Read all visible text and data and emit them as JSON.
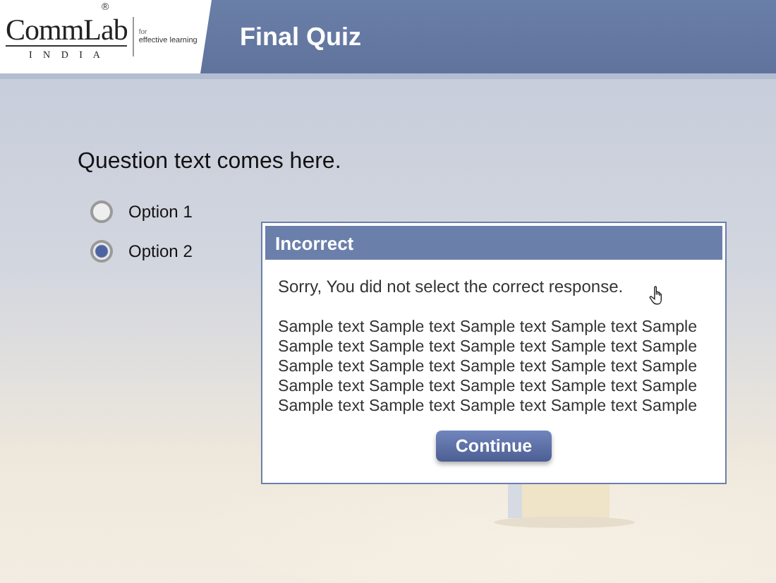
{
  "logo": {
    "name": "CommLab",
    "country": "I N D I A",
    "registered": "®",
    "for": "for",
    "tagline": "effective learning"
  },
  "title": "Final Quiz",
  "question": "Question text comes here.",
  "options": [
    {
      "label": "Option 1",
      "selected": false
    },
    {
      "label": "Option 2",
      "selected": true
    }
  ],
  "dialog": {
    "title": "Incorrect",
    "message": "Sorry, You did not select the correct response.",
    "body": "Sample text Sample text Sample text Sample text Sample Sample text Sample text Sample text Sample text Sample Sample text Sample text Sample text Sample text Sample Sample text Sample text Sample text Sample text Sample Sample text Sample text Sample text Sample text Sample",
    "button": "Continue"
  }
}
